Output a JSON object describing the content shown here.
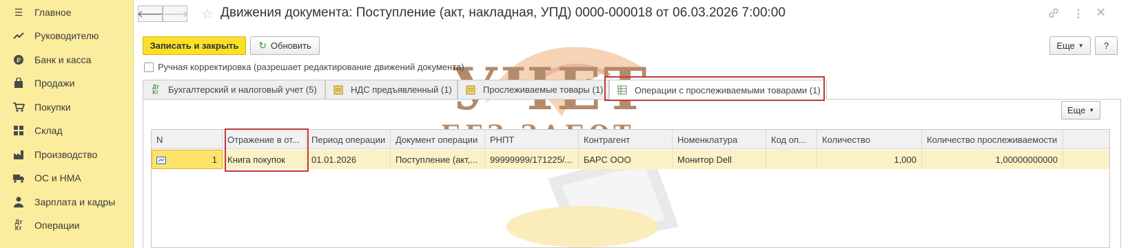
{
  "sidebar": {
    "items": [
      {
        "label": "Главное",
        "icon": "menu-icon"
      },
      {
        "label": "Руководителю",
        "icon": "trend-icon"
      },
      {
        "label": "Банк и касса",
        "icon": "coin-icon"
      },
      {
        "label": "Продажи",
        "icon": "bag-icon"
      },
      {
        "label": "Покупки",
        "icon": "cart-icon"
      },
      {
        "label": "Склад",
        "icon": "warehouse-icon"
      },
      {
        "label": "Производство",
        "icon": "factory-icon"
      },
      {
        "label": "ОС и НМА",
        "icon": "truck-icon"
      },
      {
        "label": "Зарплата и кадры",
        "icon": "person-icon"
      },
      {
        "label": "Операции",
        "icon": "dt-kt-icon"
      }
    ]
  },
  "header": {
    "back_label": "🡐",
    "forward_label": "🡒",
    "title": "Движения документа: Поступление (акт, накладная, УПД) 0000-000018 от 06.03.2026 7:00:00"
  },
  "toolbar": {
    "save_close_label": "Записать и закрыть",
    "refresh_label": "Обновить",
    "more_label": "Еще",
    "help_label": "?"
  },
  "manual_edit": {
    "label": "Ручная корректировка (разрешает редактирование движений документа)",
    "checked": false
  },
  "tabs": [
    {
      "label": "Бухгалтерский и налоговый учет (5)",
      "icon": "dt-kt-icon"
    },
    {
      "label": "НДС предъявленный (1)",
      "icon": "register-icon"
    },
    {
      "label": "Прослеживаемые товары (1)",
      "icon": "register-icon"
    },
    {
      "label": "Операции с прослеживаемыми товарами (1)",
      "icon": "table-icon",
      "active": true
    }
  ],
  "panel": {
    "more_label": "Еще"
  },
  "table": {
    "columns": [
      "N",
      "Отражение в от...",
      "Период операции",
      "Документ операции",
      "РНПТ",
      "Контрагент",
      "Номенклатура",
      "Код оп...",
      "Количество",
      "Количество прослеживаемости"
    ],
    "rows": [
      {
        "n": "1",
        "reflection": "Книга покупок",
        "period": "01.01.2026",
        "document": "Поступление (акт,...",
        "rnpt": "99999999/171225/...",
        "counterparty": "БАРС ООО",
        "nomenclature": "Монитор Dell",
        "code": "",
        "quantity": "1,000",
        "trace_quantity": "1,00000000000"
      }
    ]
  },
  "watermark": {
    "line1": "УЧЕТ",
    "line2": "БЕЗ ЗАБОТ"
  },
  "colors": {
    "sidebar_bg": "#fbed9e",
    "primary_button": "#fbdf2a",
    "highlight_border": "#c0393b",
    "selected_row": "#fbf1c6"
  }
}
